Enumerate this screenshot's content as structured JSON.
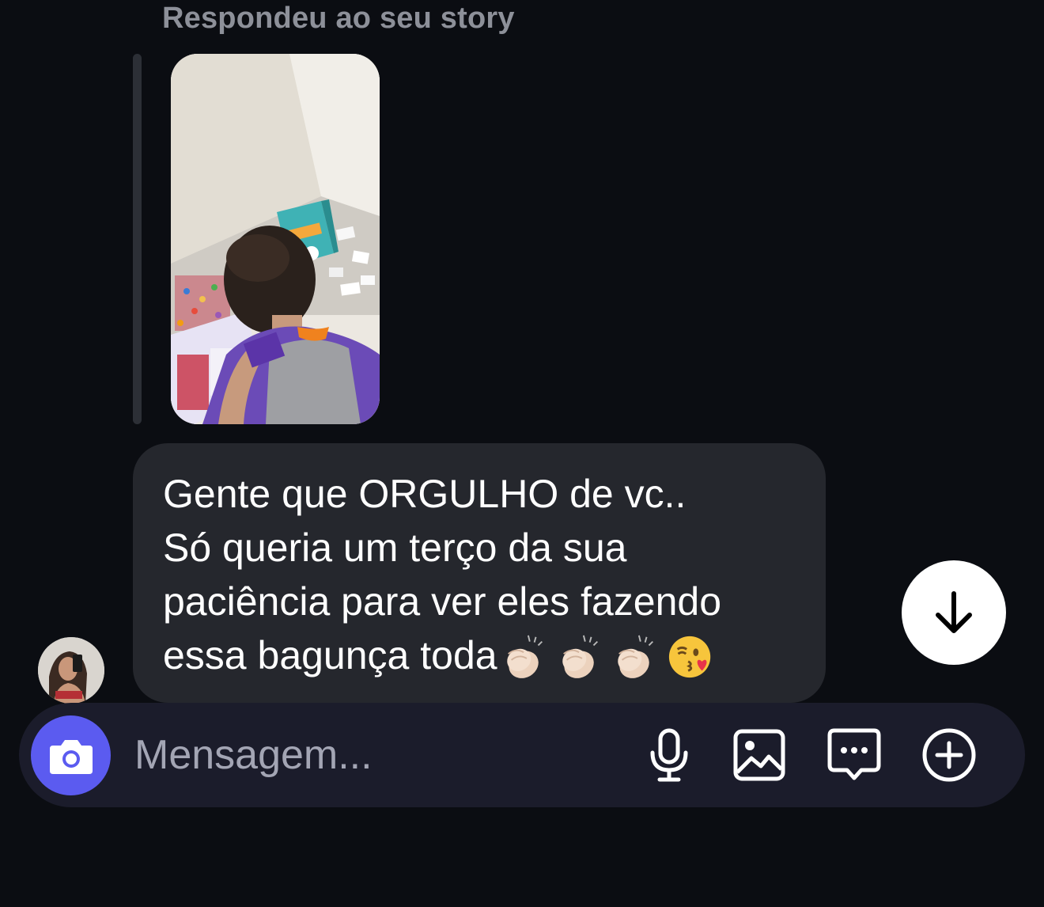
{
  "reply_context": {
    "caption": "Respondeu ao seu story"
  },
  "message": {
    "lines": [
      "Gente que ORGULHO de vc..",
      "Só queria um terço da sua",
      "paciência para ver eles fazendo",
      "essa bagunça toda"
    ],
    "emojis": [
      "clapping-hands",
      "clapping-hands",
      "clapping-hands",
      "face-blowing-kiss"
    ]
  },
  "composer": {
    "placeholder": "Mensagem..."
  },
  "icons": {
    "camera": "camera-icon",
    "mic": "microphone-icon",
    "gallery": "image-gallery-icon",
    "sticker": "chat-bubble-icon",
    "more": "plus-circle-icon",
    "scroll": "arrow-down-icon"
  },
  "colors": {
    "background": "#0b0d12",
    "bubble": "#25272d",
    "composer": "#1b1c2b",
    "camera_button": "#5b5bf0",
    "caption_text": "#8d9099",
    "placeholder_text": "#a3a5b4"
  }
}
